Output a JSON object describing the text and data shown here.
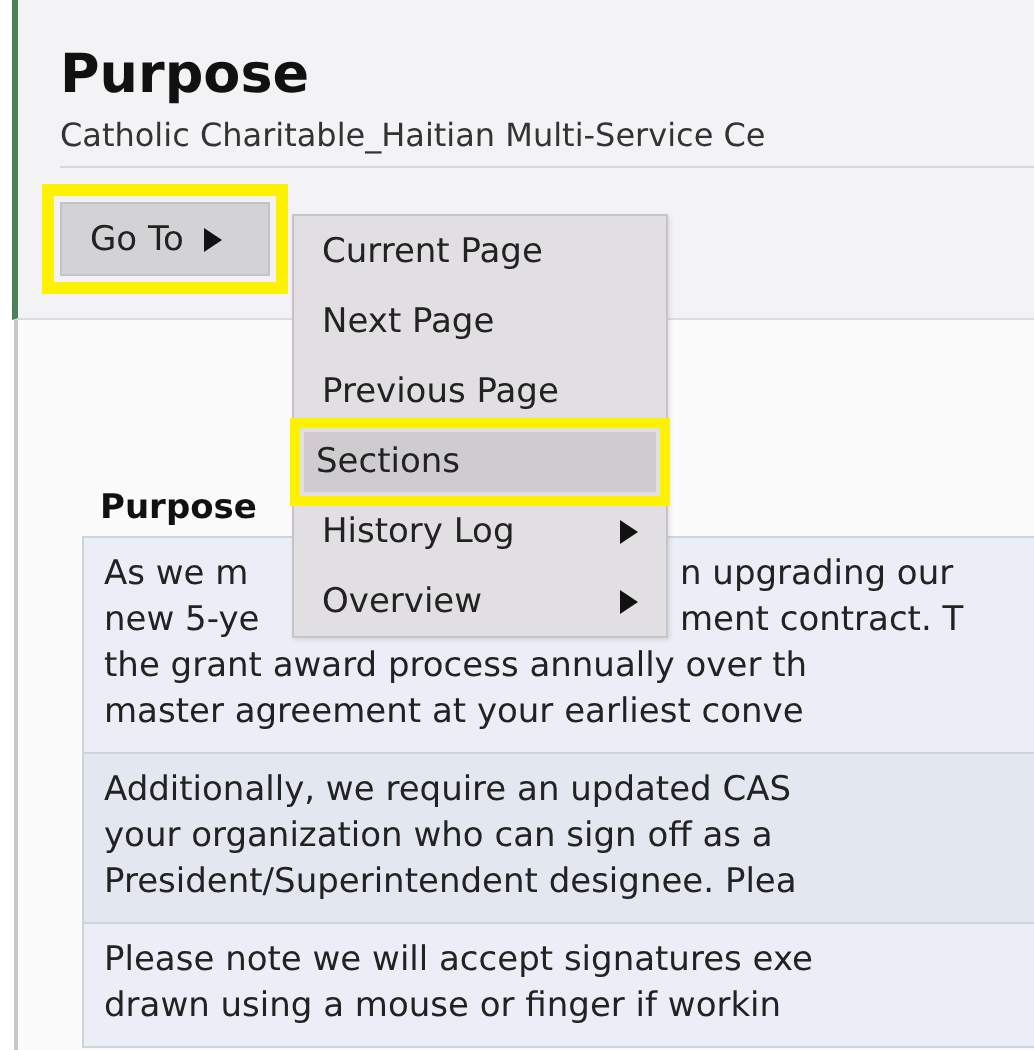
{
  "header": {
    "title": "Purpose",
    "subtitle": "Catholic Charitable_Haitian Multi-Service Ce"
  },
  "goto_button": {
    "label": "Go To",
    "highlighted": true
  },
  "menu": {
    "items": [
      {
        "label": "Current Page",
        "submenu": false,
        "selected": false,
        "highlighted": false
      },
      {
        "label": "Next Page",
        "submenu": false,
        "selected": false,
        "highlighted": false
      },
      {
        "label": "Previous Page",
        "submenu": false,
        "selected": false,
        "highlighted": false
      },
      {
        "label": "Sections",
        "submenu": false,
        "selected": true,
        "highlighted": true
      },
      {
        "label": "History Log",
        "submenu": true,
        "selected": false,
        "highlighted": false
      },
      {
        "label": "Overview",
        "submenu": true,
        "selected": false,
        "highlighted": false
      }
    ]
  },
  "section": {
    "heading": "Purpose",
    "paragraphs": [
      {
        "lines": [
          [
            "As we m",
            "n upgrading our"
          ],
          [
            "new 5-ye",
            "ment contract. T"
          ],
          [
            "the grant award process annually over th"
          ],
          [
            "master agreement at your earliest conve"
          ]
        ]
      },
      {
        "lines": [
          [
            "Additionally, we require an updated CAS"
          ],
          [
            "your organization who can sign off as a"
          ],
          [
            "President/Superintendent designee. Plea"
          ]
        ]
      },
      {
        "lines": [
          [
            "Please note we will accept signatures exe"
          ],
          [
            "drawn using a mouse or finger if workin"
          ]
        ]
      }
    ]
  }
}
